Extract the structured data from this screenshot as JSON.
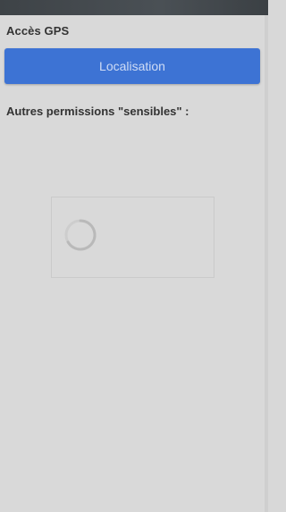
{
  "gps": {
    "label": "Accès GPS",
    "button_label": "Localisation"
  },
  "permissions": {
    "label": "Autres permissions \"sensibles\" :"
  },
  "icons": {
    "spinner": "loading-spinner-icon"
  },
  "colors": {
    "accent": "#3d73d4",
    "background": "#d9d9d9",
    "status_bar": "#444a4e"
  }
}
